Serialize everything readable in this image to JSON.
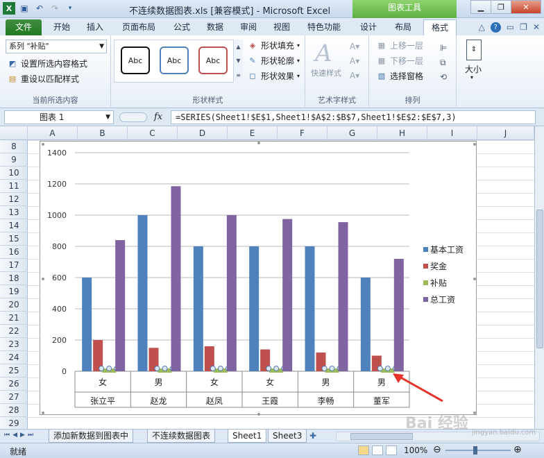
{
  "window": {
    "title": "不连续数据图表.xls  [兼容模式]  -  Microsoft Excel",
    "context_tab": "图表工具"
  },
  "ribbon_tabs": [
    "文件",
    "开始",
    "插入",
    "页面布局",
    "公式",
    "数据",
    "审阅",
    "视图",
    "特色功能",
    "设计",
    "布局",
    "格式"
  ],
  "active_tab": "格式",
  "ribbon": {
    "current_selection": {
      "series_value": "系列 \"补贴\"",
      "format_selection": "设置所选内容格式",
      "reset_style": "重设以匹配样式",
      "label": "当前所选内容"
    },
    "shape_styles": {
      "thumbs": [
        "Abc",
        "Abc",
        "Abc"
      ],
      "fill": "形状填充",
      "outline": "形状轮廓",
      "effects": "形状效果",
      "label": "形状样式"
    },
    "wordart": {
      "quick_styles": "快速样式",
      "label": "艺术字样式"
    },
    "arrange": {
      "bring_forward": "上移一层",
      "send_backward": "下移一层",
      "selection_pane": "选择窗格",
      "label": "排列"
    },
    "size": {
      "label": "大小"
    }
  },
  "formula_bar": {
    "name_box": "图表 1",
    "fx": "fx",
    "formula": "=SERIES(Sheet1!$E$1,Sheet1!$A$2:$B$7,Sheet1!$E$2:$E$7,3)"
  },
  "columns": [
    "A",
    "B",
    "C",
    "D",
    "E",
    "F",
    "G",
    "H",
    "I",
    "J"
  ],
  "rows": [
    "8",
    "9",
    "10",
    "11",
    "12",
    "13",
    "14",
    "15",
    "16",
    "17",
    "18",
    "19",
    "20",
    "21",
    "22",
    "23",
    "24",
    "25",
    "26",
    "27",
    "28",
    "29"
  ],
  "chart_data": {
    "type": "bar",
    "categories": [
      {
        "gender": "女",
        "name": "张立平"
      },
      {
        "gender": "男",
        "name": "赵龙"
      },
      {
        "gender": "女",
        "name": "赵凤"
      },
      {
        "gender": "女",
        "name": "王霞"
      },
      {
        "gender": "男",
        "name": "李畅"
      },
      {
        "gender": "男",
        "name": "董军"
      }
    ],
    "series": [
      {
        "name": "基本工资",
        "color": "#4f81bd",
        "values": [
          600,
          1000,
          800,
          800,
          800,
          600
        ]
      },
      {
        "name": "奖金",
        "color": "#c0504d",
        "values": [
          200,
          150,
          160,
          140,
          120,
          100
        ]
      },
      {
        "name": "补贴",
        "color": "#9bbb59",
        "values": [
          0,
          0,
          0,
          0,
          0,
          0
        ]
      },
      {
        "name": "总工资",
        "color": "#8064a2",
        "values": [
          840,
          1185,
          1000,
          975,
          955,
          720
        ]
      }
    ],
    "ylim": [
      0,
      1400
    ],
    "yticks": [
      "0",
      "200",
      "400",
      "600",
      "800",
      "1000",
      "1200",
      "1400"
    ],
    "legend_position": "right",
    "gridlines": true
  },
  "sheet_tabs": [
    "添加新数据到图表中",
    "不连续数据图表",
    "Sheet1",
    "Sheet3"
  ],
  "active_sheet": "Sheet1",
  "status": {
    "ready": "就绪",
    "zoom": "100%"
  },
  "watermark": "Bai 经验",
  "watermark_url": "jingyan.baidu.com"
}
